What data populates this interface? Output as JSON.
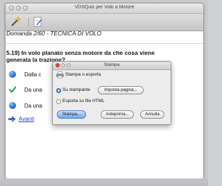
{
  "window": {
    "title": "VDSQuiz per Volo a Motore"
  },
  "toolbar": {
    "items": [
      {
        "icon": "wand-icon"
      },
      {
        "icon": "note-icon"
      }
    ]
  },
  "quiz": {
    "header": "Domanda 2/60 - TECNICA DI VOLO",
    "question_line1": "5.19) In volo planato senza motore da che cosa viene",
    "question_line2": "generata la trazione?",
    "answers": [
      {
        "text": "Dalla c",
        "icon": "blue-dot-icon"
      },
      {
        "text": "Da una",
        "icon": "check-icon"
      },
      {
        "text": "Da una",
        "icon": "blue-dot-icon"
      }
    ],
    "next_label": "Avanti"
  },
  "print_dialog": {
    "title": "Stampa",
    "heading": "Stampa o esporta",
    "option_printer": "Su stampante",
    "page_setup_label": "Imposta pagina...",
    "option_html": "Esporta su file HTML",
    "print_button": "Stampa...",
    "preview_button": "Anteprima...",
    "cancel_button": "Annulla"
  },
  "colors": {
    "link": "#1d3fc7",
    "accent": "#3a7bd5",
    "check": "#2ea043"
  }
}
